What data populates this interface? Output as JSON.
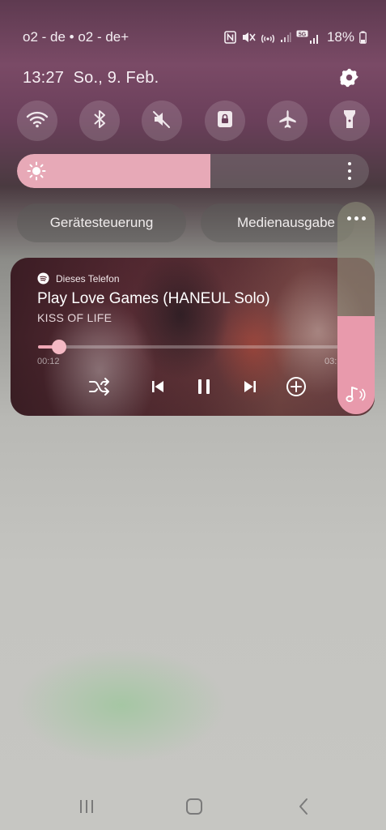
{
  "status_bar": {
    "carrier": "o2 - de • o2 - de+",
    "battery": "18%",
    "icons": [
      "nfc-icon",
      "mute-icon",
      "hotspot-icon",
      "signal-icon",
      "5g-signal-icon",
      "battery-icon"
    ],
    "network_badge": "5G"
  },
  "header": {
    "time": "13:27",
    "date": "So., 9. Feb.",
    "settings_icon": "gear-icon"
  },
  "quick_toggles": [
    {
      "icon": "wifi-icon",
      "active": false
    },
    {
      "icon": "bluetooth-icon",
      "active": false
    },
    {
      "icon": "sound-mute-icon",
      "active": false
    },
    {
      "icon": "rotation-lock-icon",
      "active": false
    },
    {
      "icon": "airplane-mode-icon",
      "active": false
    },
    {
      "icon": "flashlight-icon",
      "active": false
    }
  ],
  "brightness": {
    "level": 0.55,
    "icon": "sun-icon",
    "fill_color": "#e7a9b7"
  },
  "buttons": {
    "device_control": "Gerätesteuerung",
    "media_output": "Medienausgabe"
  },
  "media": {
    "source": "Dieses Telefon",
    "source_icon": "spotify-icon",
    "title": "Play Love Games (HANEUL Solo)",
    "artist": "KISS OF LIFE",
    "elapsed": "00:12",
    "total": "03:",
    "progress": 0.07,
    "accent": "#f0a7b5",
    "controls": [
      "shuffle-icon",
      "previous-icon",
      "pause-icon",
      "next-icon",
      "add-icon"
    ]
  },
  "volume": {
    "level": 0.46,
    "icon": "music-note-icon",
    "fill_color": "#e89aac"
  },
  "navigation": [
    "recents-icon",
    "home-icon",
    "back-icon"
  ]
}
